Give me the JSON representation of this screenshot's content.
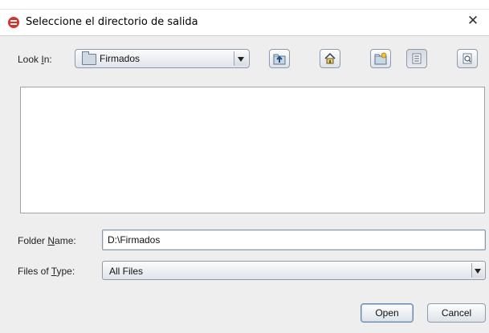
{
  "window": {
    "title": "Seleccione el directorio de salida",
    "close_glyph": "✕"
  },
  "look_in": {
    "label_pre": "Look ",
    "label_mnemonic": "I",
    "label_post": "n:",
    "value": "Firmados"
  },
  "toolbar": {
    "buttons": [
      "up-one-level-icon",
      "home-icon",
      "new-folder-icon",
      "list-view-icon",
      "details-view-icon"
    ],
    "pressed": "list-view-icon"
  },
  "folder_name": {
    "label_pre": "Folder ",
    "label_mnemonic": "N",
    "label_post": "ame:",
    "value": "D:\\Firmados"
  },
  "files_of_type": {
    "label_pre": "Files of ",
    "label_mnemonic": "T",
    "label_post": "ype:",
    "value": "All Files"
  },
  "buttons": {
    "open": "Open",
    "cancel": "Cancel"
  },
  "colors": {
    "app_icon": "#d8332a",
    "dialog_bg": "#eeeeee",
    "focus_border": "#6a86a8"
  }
}
